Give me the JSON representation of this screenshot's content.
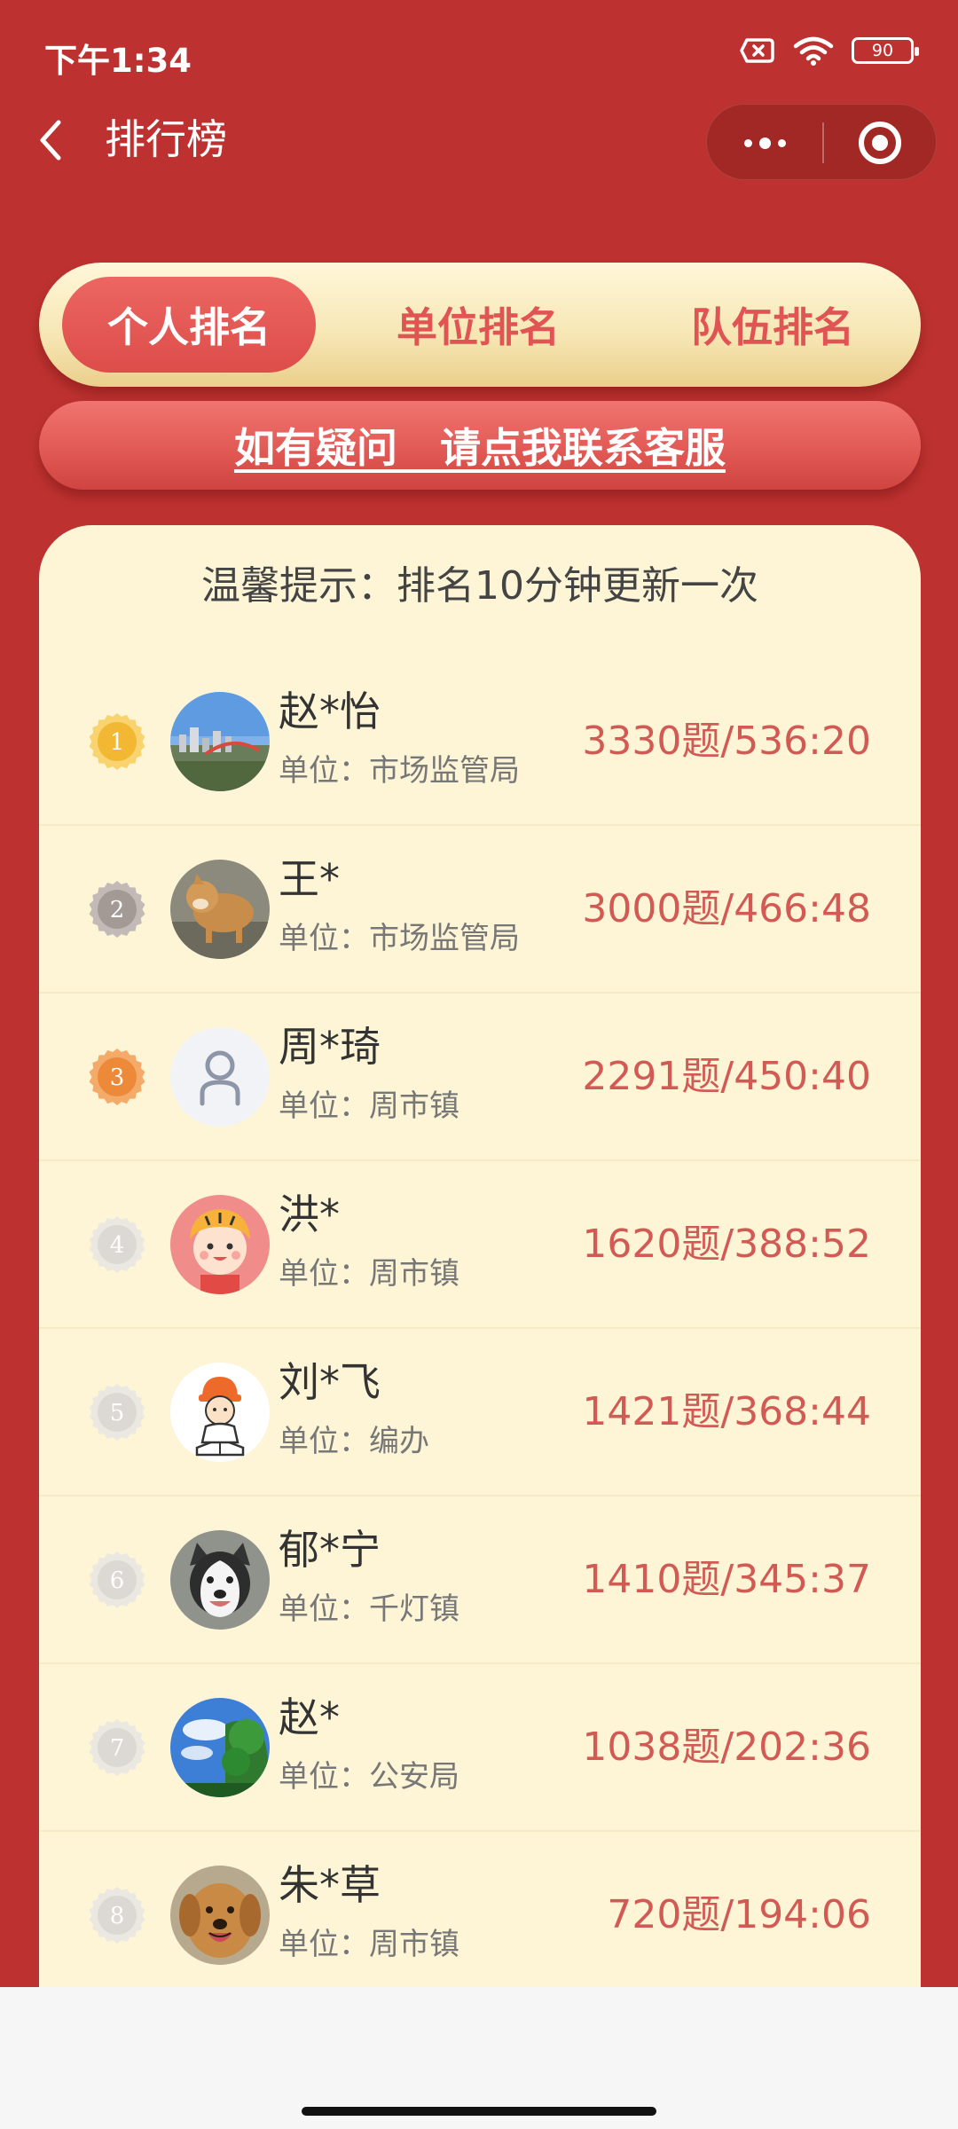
{
  "status_bar": {
    "time": "下午1:34",
    "battery": "90"
  },
  "nav": {
    "title": "排行榜"
  },
  "tabs": [
    {
      "label": "个人排名",
      "active": true
    },
    {
      "label": "单位排名",
      "active": false
    },
    {
      "label": "队伍排名",
      "active": false
    }
  ],
  "contact": {
    "label": "如有疑问   请点我联系客服"
  },
  "tip": "温馨提示：排名10分钟更新一次",
  "ranking": [
    {
      "rank": "1",
      "name": "赵*怡",
      "unit": "单位：市场监管局",
      "score": "3330题/536:20",
      "medal": "gold",
      "avatar": "city"
    },
    {
      "rank": "2",
      "name": "王*",
      "unit": "单位：市场监管局",
      "score": "3000题/466:48",
      "medal": "silver",
      "avatar": "dog-shiba"
    },
    {
      "rank": "3",
      "name": "周*琦",
      "unit": "单位：周市镇",
      "score": "2291题/450:40",
      "medal": "bronze",
      "avatar": "default-user"
    },
    {
      "rank": "4",
      "name": "洪*",
      "unit": "单位：周市镇",
      "score": "1620题/388:52",
      "medal": "plain",
      "avatar": "tiger-kid"
    },
    {
      "rank": "5",
      "name": "刘*飞",
      "unit": "单位：编办",
      "score": "1421题/368:44",
      "medal": "plain",
      "avatar": "cartoon-reader"
    },
    {
      "rank": "6",
      "name": "郁*宁",
      "unit": "单位：千灯镇",
      "score": "1410题/345:37",
      "medal": "plain",
      "avatar": "husky"
    },
    {
      "rank": "7",
      "name": "赵*",
      "unit": "单位：公安局",
      "score": "1038题/202:36",
      "medal": "plain",
      "avatar": "sky-tree"
    },
    {
      "rank": "8",
      "name": "朱*草",
      "unit": "单位：周市镇",
      "score": "720题/194:06",
      "medal": "plain",
      "avatar": "golden-retriever"
    }
  ],
  "colors": {
    "background": "#bd3230",
    "accent": "#e05454",
    "card": "#fdf5d6",
    "gold": "#f2b733",
    "silver": "#a39a96",
    "bronze": "#ec8a3a"
  }
}
